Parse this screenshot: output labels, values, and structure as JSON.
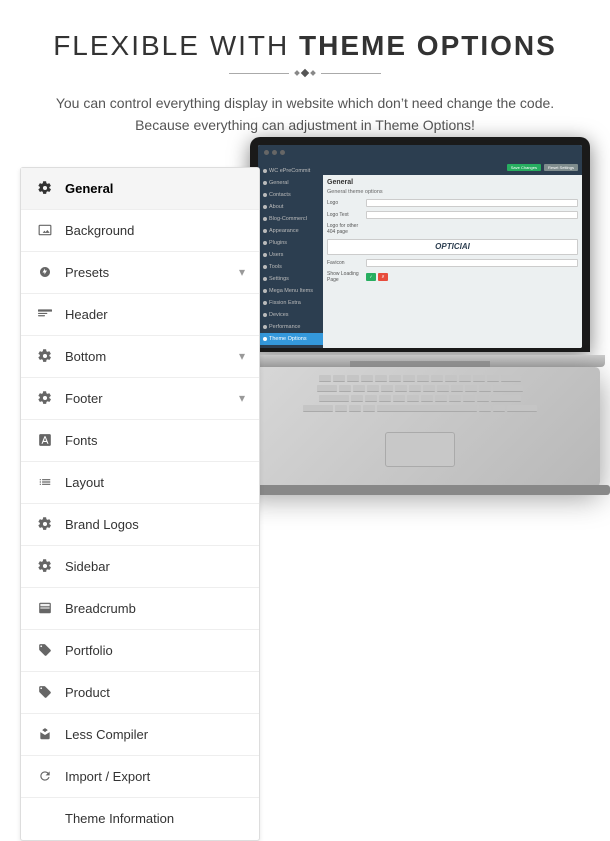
{
  "header": {
    "title_normal": "FLEXIBLE WITH",
    "title_bold": "THEME OPTIONS",
    "description_line1": "You can control everything display in website which don’t need change the code.",
    "description_line2": "Because everything can adjustment in Theme Options!",
    "divider": "♦"
  },
  "menu": {
    "items": [
      {
        "id": "general",
        "label": "General",
        "icon": "gear",
        "active": true,
        "has_arrow": false
      },
      {
        "id": "background",
        "label": "Background",
        "icon": "image",
        "active": false,
        "has_arrow": false
      },
      {
        "id": "presets",
        "label": "Presets",
        "icon": "drop",
        "active": false,
        "has_arrow": true
      },
      {
        "id": "header",
        "label": "Header",
        "icon": "header-icon",
        "active": false,
        "has_arrow": false
      },
      {
        "id": "bottom",
        "label": "Bottom",
        "icon": "gear",
        "active": false,
        "has_arrow": true
      },
      {
        "id": "footer",
        "label": "Footer",
        "icon": "gear",
        "active": false,
        "has_arrow": true
      },
      {
        "id": "fonts",
        "label": "Fonts",
        "icon": "font",
        "active": false,
        "has_arrow": false
      },
      {
        "id": "layout",
        "label": "Layout",
        "icon": "layout",
        "active": false,
        "has_arrow": false
      },
      {
        "id": "brand-logos",
        "label": "Brand Logos",
        "icon": "gear",
        "active": false,
        "has_arrow": false
      },
      {
        "id": "sidebar",
        "label": "Sidebar",
        "icon": "gear",
        "active": false,
        "has_arrow": false
      },
      {
        "id": "breadcrumb",
        "label": "Breadcrumb",
        "icon": "breadcrumb",
        "active": false,
        "has_arrow": false
      },
      {
        "id": "portfolio",
        "label": "Portfolio",
        "icon": "tag",
        "active": false,
        "has_arrow": false
      },
      {
        "id": "product",
        "label": "Product",
        "icon": "tag",
        "active": false,
        "has_arrow": false
      },
      {
        "id": "less-compiler",
        "label": "Less Compiler",
        "icon": "wrench",
        "active": false,
        "has_arrow": false
      },
      {
        "id": "import-export",
        "label": "Import / Export",
        "icon": "refresh",
        "active": false,
        "has_arrow": false
      },
      {
        "id": "theme-information",
        "label": "Theme Information",
        "icon": "none",
        "active": false,
        "has_arrow": false
      }
    ]
  },
  "screen": {
    "left_nav": [
      "WC ePreCommit",
      "General",
      "Contacts",
      "About",
      "Blog-CommercI",
      "Appearance",
      "Plugins",
      "Users",
      "Tools",
      "Settings",
      "Mega Menu Items",
      "Fission Extra",
      "Devices",
      "Performance",
      "Theme Options"
    ],
    "active_nav": "Theme Options",
    "content_title": "General",
    "content_subtitle": "General theme options",
    "save_btn": "Save Changes",
    "preview_btn": "Reset Settings",
    "logo_text": "OPTICIAI",
    "fields": [
      {
        "label": "Logo",
        "type": "file"
      },
      {
        "label": "Logo Text",
        "type": "text"
      },
      {
        "label": "Logo for other 404 page",
        "type": "file"
      },
      {
        "label": "Favicon",
        "type": "file"
      },
      {
        "label": "Show Loading Page",
        "type": "toggle"
      }
    ]
  },
  "colors": {
    "accent_blue": "#3498db",
    "save_green": "#27ae60",
    "dark_bg": "#1a1a2e",
    "menu_border": "#dddddd",
    "active_bg": "#f5f5f5"
  }
}
